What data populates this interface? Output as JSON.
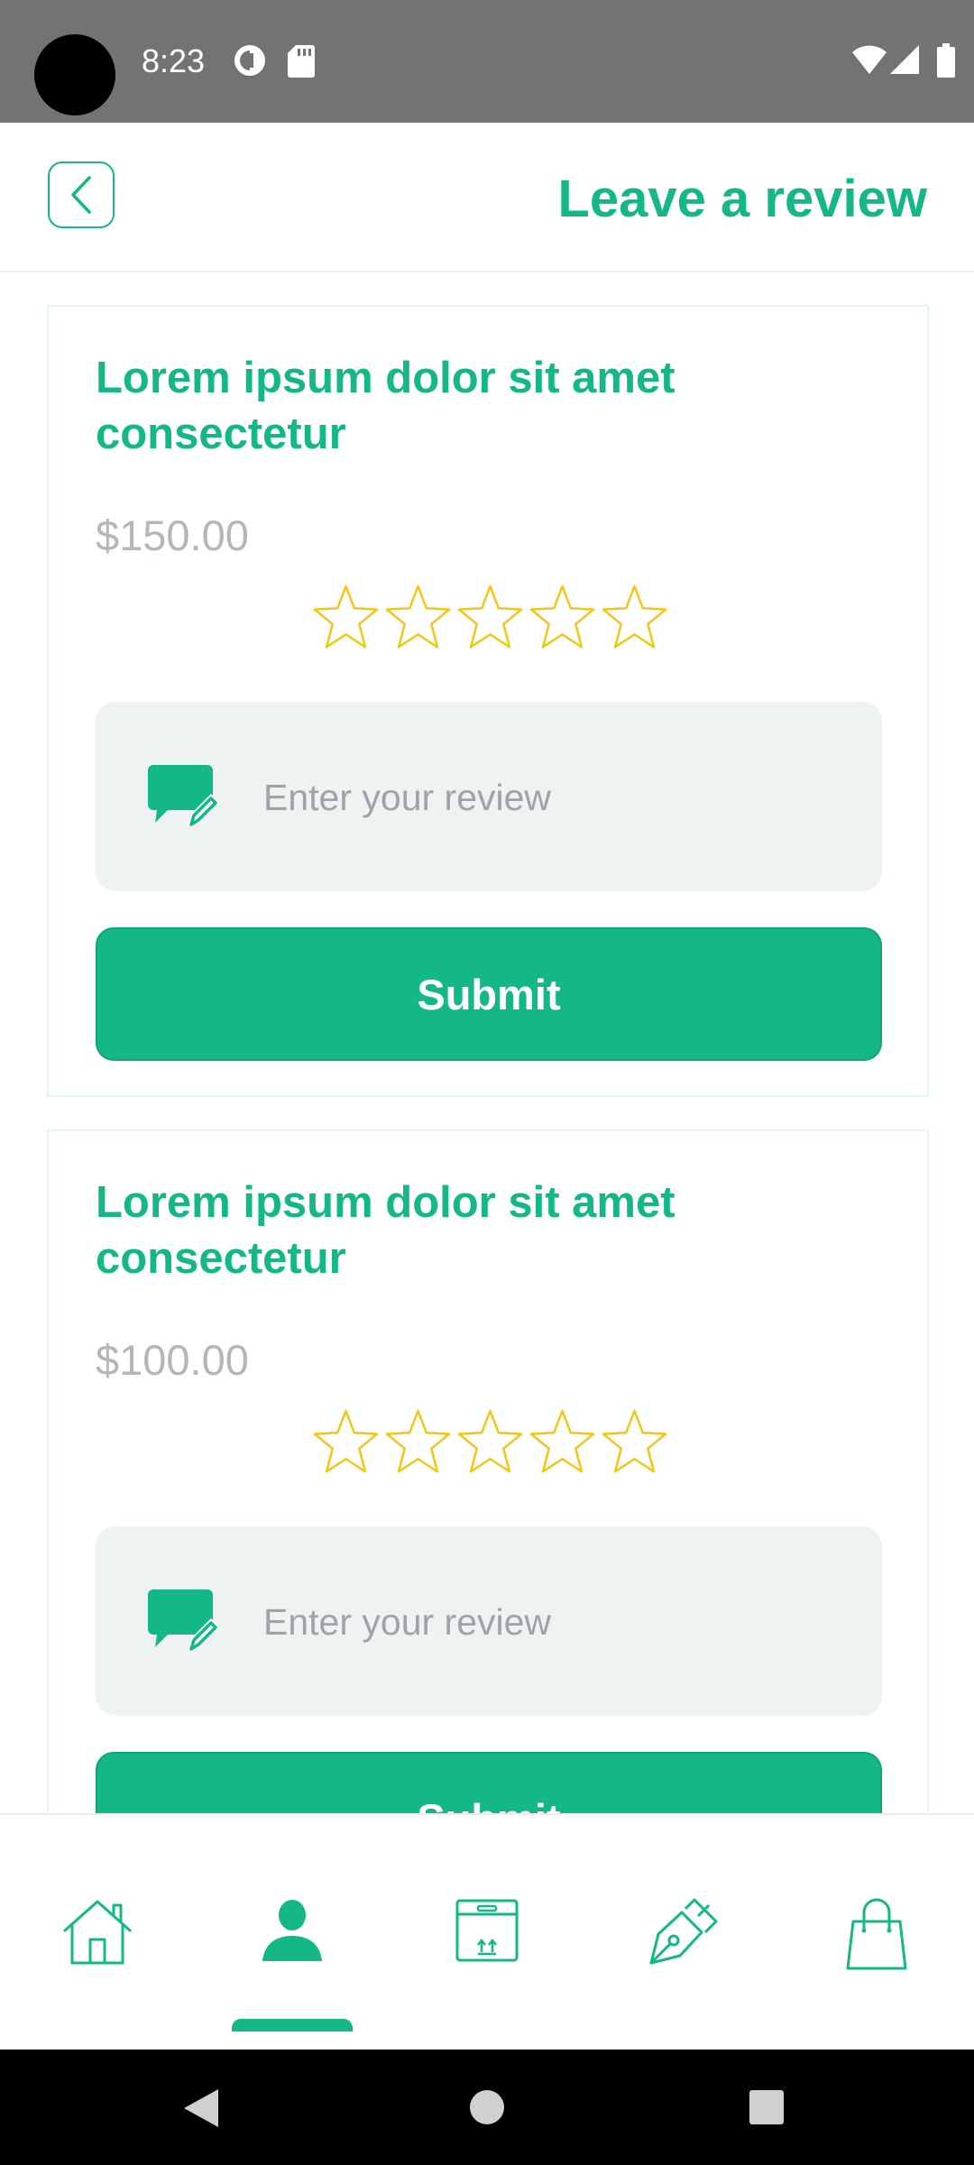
{
  "status_bar": {
    "time": "8:23",
    "icons": [
      "camera-cutout",
      "sync-icon",
      "sd-card-icon",
      "wifi-icon",
      "signal-icon",
      "battery-icon"
    ]
  },
  "header": {
    "title": "Leave a review",
    "back_icon": "chevron-left-icon"
  },
  "reviews": [
    {
      "product_title": "Lorem ipsum dolor sit amet consectetur",
      "price": "$150.00",
      "rating": 0,
      "max_rating": 5,
      "review_placeholder": "Enter your review",
      "review_value": "",
      "submit_label": "Submit"
    },
    {
      "product_title": "Lorem ipsum dolor sit amet consectetur",
      "price": "$100.00",
      "rating": 0,
      "max_rating": 5,
      "review_placeholder": "Enter your review",
      "review_value": "",
      "submit_label": "Submit"
    }
  ],
  "bottom_nav": {
    "items": [
      "home-icon",
      "person-icon",
      "box-icon",
      "pen-nib-icon",
      "shopping-bag-icon"
    ],
    "active": "person-icon"
  },
  "system_nav": [
    "back-triangle",
    "home-circle",
    "recents-square"
  ],
  "colors": {
    "accent": "#14b886",
    "star": "#f4c518",
    "input_bg": "#eff2f3",
    "price": "#b3b7ba",
    "status_bar": "#737373"
  }
}
